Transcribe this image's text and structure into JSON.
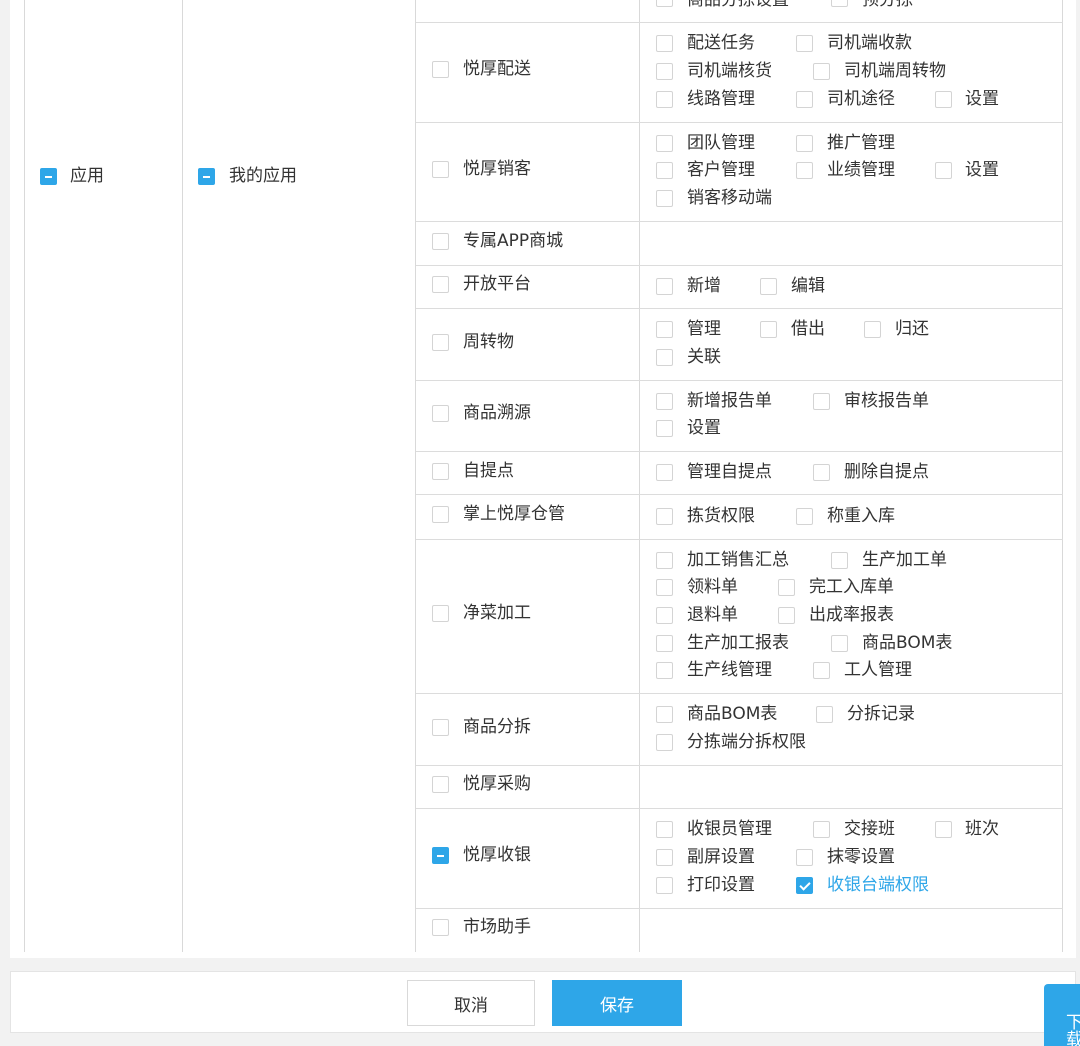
{
  "level1": {
    "label": "应用"
  },
  "level2": {
    "label": "我的应用"
  },
  "modules": [
    {
      "label": "悦厚配送",
      "perms": [
        "配送任务",
        "司机端收款",
        "司机端核货",
        "司机端周转物",
        "线路管理",
        "司机途径",
        "设置"
      ]
    },
    {
      "label": "悦厚销客",
      "perms": [
        "团队管理",
        "推广管理",
        "客户管理",
        "业绩管理",
        "设置",
        "销客移动端"
      ]
    },
    {
      "label": "专属APP商城",
      "perms": []
    },
    {
      "label": "开放平台",
      "perms": [
        "新增",
        "编辑"
      ]
    },
    {
      "label": "周转物",
      "perms": [
        "管理",
        "借出",
        "归还",
        "关联"
      ]
    },
    {
      "label": "商品溯源",
      "perms": [
        "新增报告单",
        "审核报告单",
        "设置"
      ]
    },
    {
      "label": "自提点",
      "perms": [
        "管理自提点",
        "删除自提点"
      ]
    },
    {
      "label": "掌上悦厚仓管",
      "perms": [
        "拣货权限",
        "称重入库"
      ]
    },
    {
      "label": "净菜加工",
      "perms": [
        "加工销售汇总",
        "生产加工单",
        "领料单",
        "完工入库单",
        "退料单",
        "出成率报表",
        "生产加工报表",
        "商品BOM表",
        "生产线管理",
        "工人管理"
      ]
    },
    {
      "label": "商品分拆",
      "perms": [
        "商品BOM表",
        "分拆记录",
        "分拣端分拆权限"
      ]
    },
    {
      "label": "悦厚采购",
      "perms": []
    },
    {
      "label": "悦厚收银",
      "perms": [
        "收银员管理",
        "交接班",
        "班次",
        "副屏设置",
        "抹零设置",
        "打印设置",
        "收银台端权限"
      ]
    },
    {
      "label": "市场助手",
      "perms": []
    }
  ],
  "top_partial": {
    "left": "商品分拣设置",
    "right": "预分拣"
  },
  "footer": {
    "cancel": "取消",
    "save": "保存"
  },
  "side_tab": {
    "label": "下载"
  },
  "colors": {
    "accent": "#2ea6e8",
    "border": "#d9d9d9",
    "background": "#f2f2f2"
  }
}
